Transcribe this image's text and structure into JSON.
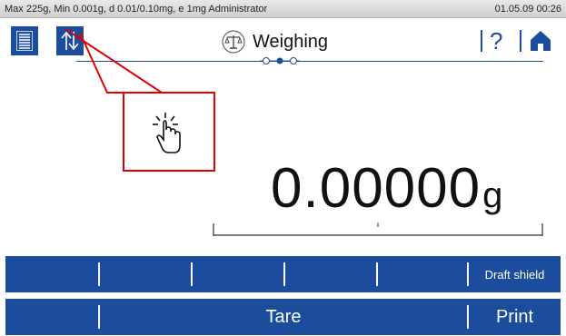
{
  "status": {
    "left_text": "Max 225g, Min 0.001g, d 0.01/0.10mg, e 1mg  Administrator",
    "datetime": "01.05.09 00:26"
  },
  "header": {
    "title": "Weighing",
    "help_label": "?"
  },
  "display": {
    "value": "0.00000",
    "unit": "g"
  },
  "function_keys": {
    "row1": [
      "",
      "",
      "",
      "",
      "Draft shield"
    ],
    "row2": [
      "",
      "Tare",
      "Print"
    ]
  },
  "colors": {
    "accent": "#1c4c9c",
    "annotation": "#e00000"
  },
  "icons": [
    "list-icon",
    "switch-icon",
    "scale-icon",
    "help-icon",
    "home-icon",
    "tap-hand-icon"
  ]
}
